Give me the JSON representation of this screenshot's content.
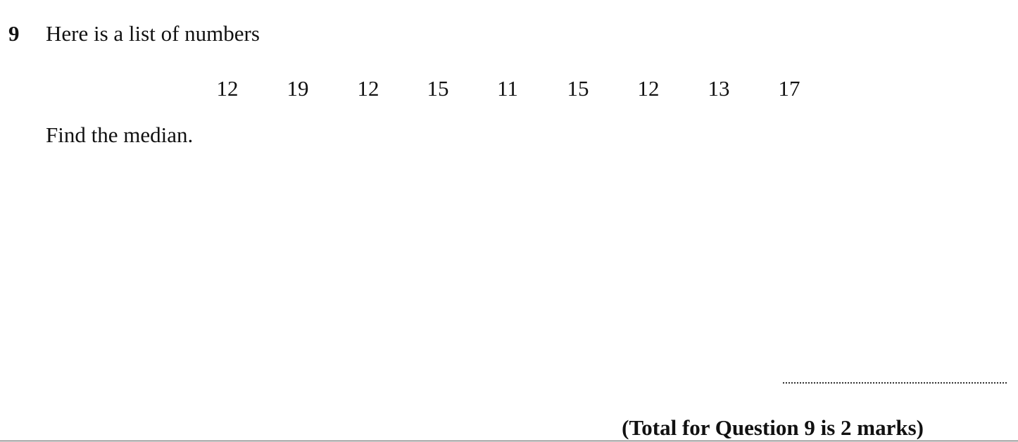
{
  "question": {
    "number": "9",
    "intro": "Here is a list of numbers",
    "numbers": [
      "12",
      "19",
      "12",
      "15",
      "11",
      "15",
      "12",
      "13",
      "17"
    ],
    "instruction": "Find the median.",
    "total": "(Total for Question 9 is 2 marks)"
  }
}
